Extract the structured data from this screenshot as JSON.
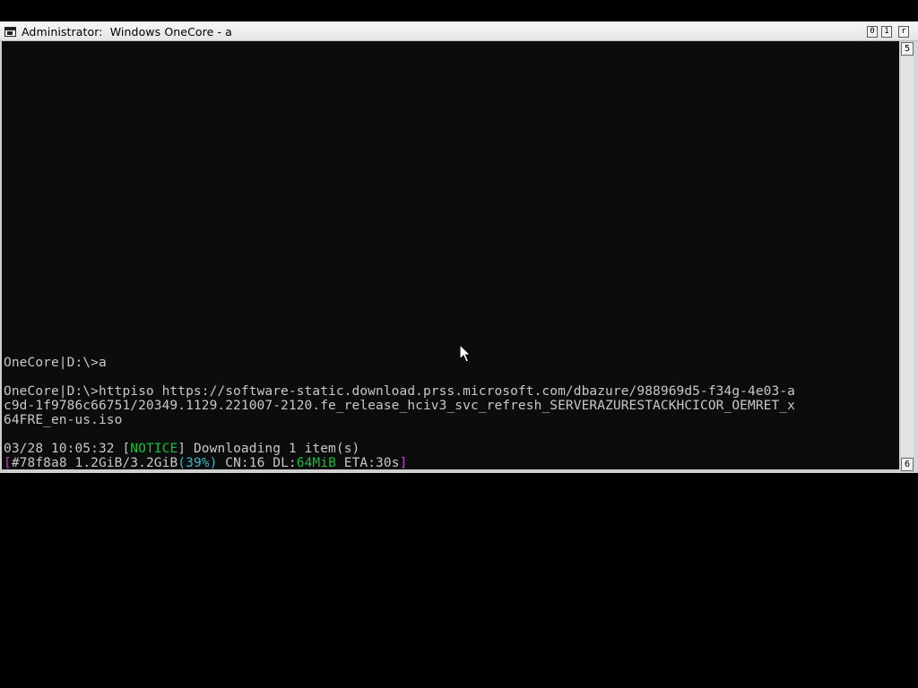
{
  "window": {
    "title": "Administrator:  Windows OneCore - a",
    "buttons": {
      "minimize": "0",
      "maximize": "1",
      "close": "r"
    }
  },
  "scrollbar": {
    "up_glyph": "5",
    "down_glyph": "6"
  },
  "console": {
    "prompt1": "OneCore|D:\\>a",
    "prompt2_line1": "OneCore|D:\\>httpiso https://software-static.download.prss.microsoft.com/dbazure/988969d5-f34g-4e03-a",
    "prompt2_line2": "c9d-1f9786c66751/20349.1129.221007-2120.fe_release_hciv3_svc_refresh_SERVERAZURESTACKHCICOR_OEMRET_x",
    "prompt2_line3": "64FRE_en-us.iso",
    "notice_line": {
      "timestamp": "03/28 10:05:32 ",
      "open_bracket": "[",
      "level": "NOTICE",
      "close_bracket": "] ",
      "message": "Downloading 1 item(s)"
    },
    "progress_line": {
      "open_bracket": "[",
      "gid": "#78f8a8 ",
      "size": "1.2GiB/3.2GiB",
      "percent": "(39%)",
      "cn": " CN:16 ",
      "dl_label": "DL:",
      "dl_speed": "64MiB",
      "eta": " ETA:30s",
      "close_bracket": "]"
    }
  },
  "colors": {
    "console_bg": "#0c0c0c",
    "text": "#c8c8c8",
    "notice": "#13c03a",
    "bracket": "#c63fc6",
    "percent": "#39b8c9"
  },
  "icons": {
    "system": "console-window-icon",
    "pointer": "mouse-pointer-icon"
  }
}
